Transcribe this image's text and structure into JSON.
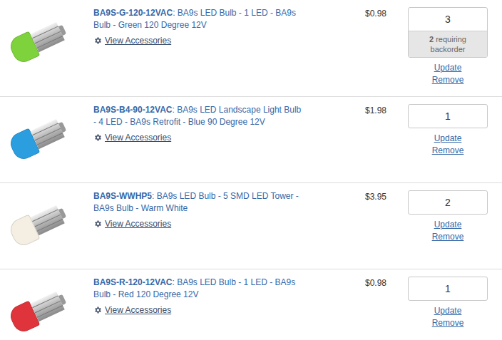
{
  "cart": {
    "items": [
      {
        "sku": "BA9S-G-120-12VAC",
        "description": ": BA9s LED Bulb - 1 LED - BA9s Bulb - Green 120 Degree 12V",
        "accessories_link": "View Accessories",
        "price": "$0.98",
        "quantity": "3",
        "backorder": {
          "count": "2",
          "text": "requiring backorder"
        },
        "update": "Update",
        "remove": "Remove",
        "color": "#7ed23c"
      },
      {
        "sku": "BA9S-B4-90-12VAC",
        "description": ": BA9s LED Landscape Light Bulb - 4 LED - BA9s Retrofit - Blue 90 Degree 12V",
        "accessories_link": "View Accessories",
        "price": "$1.98",
        "quantity": "1",
        "backorder": null,
        "update": "Update",
        "remove": "Remove",
        "color": "#2b9ee0"
      },
      {
        "sku": "BA9S-WWHP5",
        "description": ": BA9s LED Bulb - 5 SMD LED Tower - BA9s Bulb - Warm White",
        "accessories_link": "View Accessories",
        "price": "$3.95",
        "quantity": "2",
        "backorder": null,
        "update": "Update",
        "remove": "Remove",
        "color": "#f4efe2"
      },
      {
        "sku": "BA9S-R-120-12VAC",
        "description": ": BA9s LED Bulb - 1 LED - BA9s Bulb - Red 120 Degree 12V",
        "accessories_link": "View Accessories",
        "price": "$0.98",
        "quantity": "1",
        "backorder": null,
        "update": "Update",
        "remove": "Remove",
        "color": "#e0343c"
      }
    ]
  }
}
